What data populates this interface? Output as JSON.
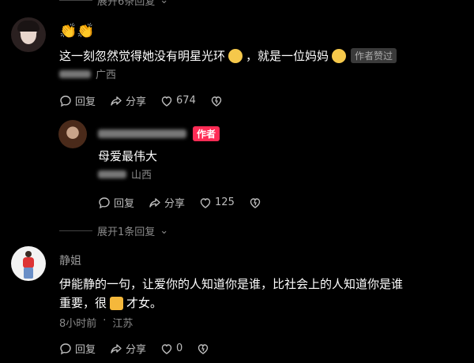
{
  "top_expand": {
    "label": "展开6条回复"
  },
  "comment1": {
    "reaction": "👏👏",
    "text_a": "这一刻忽然觉得她没有明星光环",
    "text_b": "，就是一位妈妈",
    "badge": "作者赞过",
    "location": "广西",
    "actions": {
      "reply": "回复",
      "share": "分享",
      "likes": "674"
    }
  },
  "reply1": {
    "author_badge": "作者",
    "text": "母爱最伟大",
    "location": "山西",
    "actions": {
      "reply": "回复",
      "share": "分享",
      "likes": "125"
    }
  },
  "mid_expand": {
    "label": "展开1条回复"
  },
  "comment2": {
    "username": "静姐",
    "text_line1": "伊能静的一句，让爱你的人知道你是谁，比社会上的人知道你是谁",
    "text_line2_a": "重要，很",
    "text_line2_b": "才女。",
    "time": "8小时前",
    "location": "江苏",
    "actions": {
      "reply": "回复",
      "share": "分享",
      "likes": "0"
    }
  },
  "colors": {
    "background": "#000000",
    "muted": "#8a8a8a",
    "author_red": "#ff2c55",
    "badge_gray": "#3a3a3a"
  },
  "icons": [
    "comment-icon",
    "share-icon",
    "heart-icon",
    "dislike-icon",
    "chevron-down-icon"
  ]
}
